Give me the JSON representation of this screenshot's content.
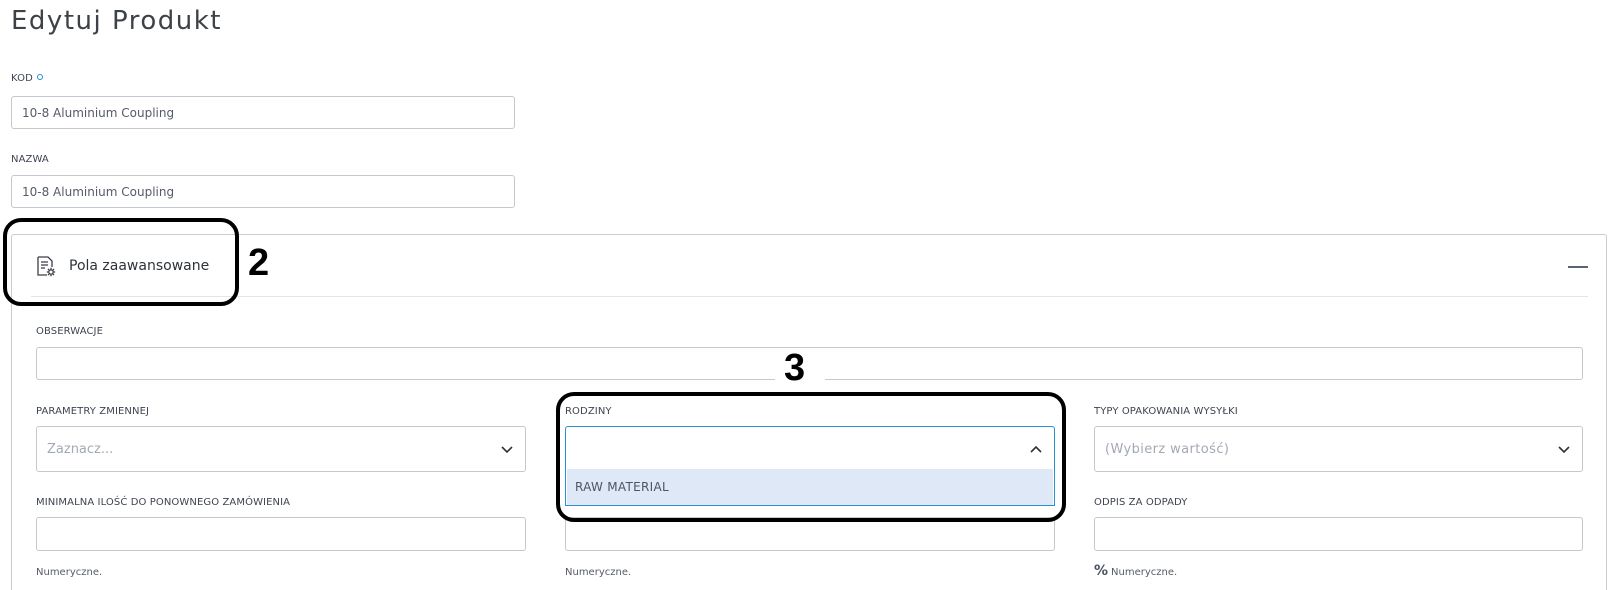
{
  "page": {
    "title": "Edytuj Produkt"
  },
  "fields": {
    "kod": {
      "label": "KOD",
      "value": "10-8 Aluminium Coupling"
    },
    "nazwa": {
      "label": "NAZWA",
      "value": "10-8 Aluminium Coupling"
    }
  },
  "advanced": {
    "title": "Pola zaawansowane",
    "observations": {
      "label": "OBSERWACJE",
      "value": ""
    },
    "variable_params": {
      "label": "PARAMETRY ZMIENNEJ",
      "placeholder": "Zaznacz..."
    },
    "families": {
      "label": "RODZINY",
      "value": "",
      "options": [
        "RAW MATERIAL"
      ]
    },
    "shipping_package_types": {
      "label": "TYPY OPAKOWANIA WYSYŁKI",
      "placeholder": "(Wybierz wartość)"
    },
    "min_reorder_qty": {
      "label": "MINIMALNA ILOŚĆ DO PONOWNEGO ZAMÓWIENIA",
      "value": "",
      "hint": "Numeryczne."
    },
    "middle_numeric": {
      "value": "",
      "hint": "Numeryczne."
    },
    "waste_writeoff": {
      "label": "ODPIS ZA ODPADY",
      "value": "",
      "unit": "%",
      "hint": "Numeryczne."
    }
  },
  "annotations": {
    "marker_2": "2",
    "marker_3": "3"
  },
  "colors": {
    "accent": "#2a8fd0",
    "option_highlight": "#dfe8f6",
    "required_dot": "#1f8ed6"
  }
}
